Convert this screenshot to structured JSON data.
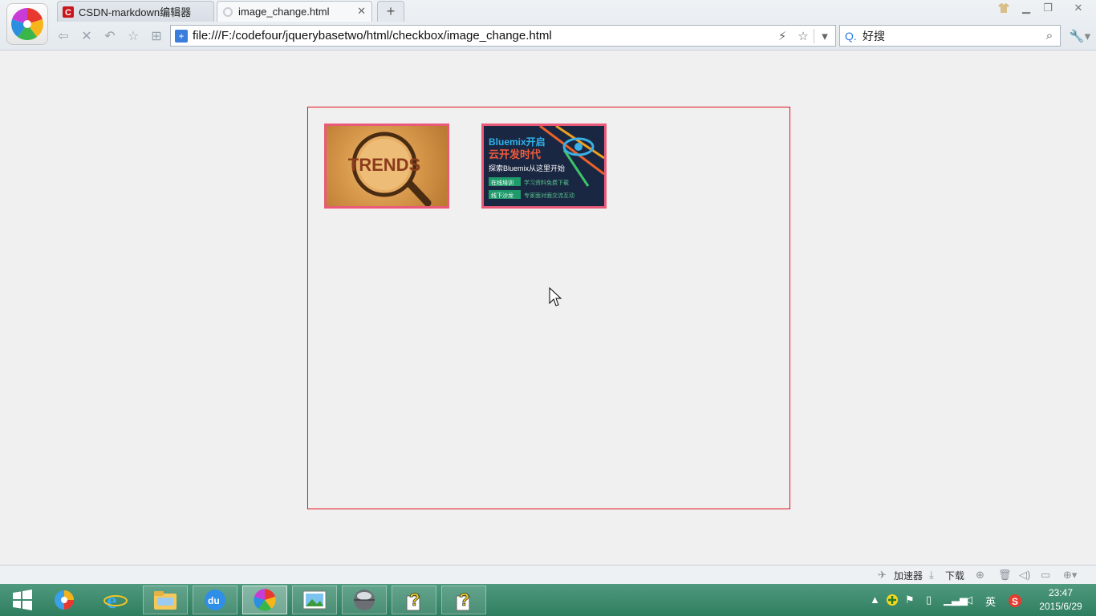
{
  "browser": {
    "tabs": [
      {
        "title": "CSDN-markdown编辑器",
        "active": false
      },
      {
        "title": "image_change.html",
        "active": true
      }
    ],
    "new_tab_label": "+",
    "address": "file:///F:/codefour/jquerybasetwo/html/checkbox/image_change.html",
    "search": {
      "engine_label": "Q.",
      "value": "好搜"
    }
  },
  "page": {
    "frame_border_color": "#e0101e",
    "images": [
      {
        "alt": "TRENDS magnifier image",
        "text": "TRENDS",
        "border_color": "#ea5a78"
      },
      {
        "alt": "Bluemix promotional banner",
        "border_color": "#ea5a78",
        "line1": "Bluemix开启",
        "line2": "云开发时代",
        "line3": "探索Bluemix从这里开始",
        "tag1": "在线培训",
        "tag1_text": "学习资料免费下载",
        "tag2": "线下沙龙",
        "tag2_text": "专家面对面交流互动"
      }
    ]
  },
  "statusbar": {
    "accelerator": "加速器",
    "download": "下载"
  },
  "taskbar": {
    "tray_lang": "英",
    "time": "23:47",
    "date": "2015/6/29"
  }
}
